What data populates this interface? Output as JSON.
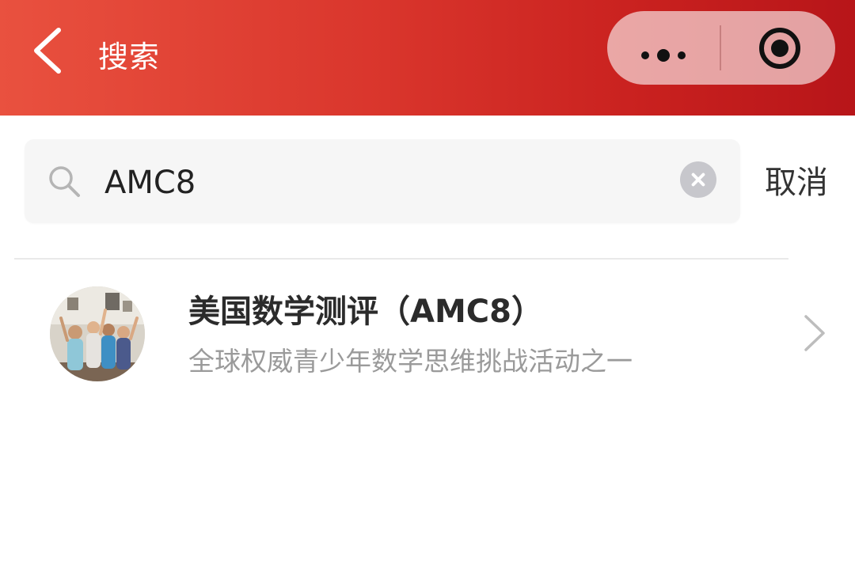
{
  "header": {
    "title": "搜索",
    "background_colors": [
      "#e9513f",
      "#b71519"
    ]
  },
  "capsule": {
    "more_icon": "more-dots-icon",
    "close_icon": "target-circle-icon"
  },
  "search": {
    "value": "AMC8",
    "cancel_label": "取消"
  },
  "results": [
    {
      "title": "美国数学测评（AMC8）",
      "description": "全球权威青少年数学思维挑战活动之一"
    }
  ]
}
